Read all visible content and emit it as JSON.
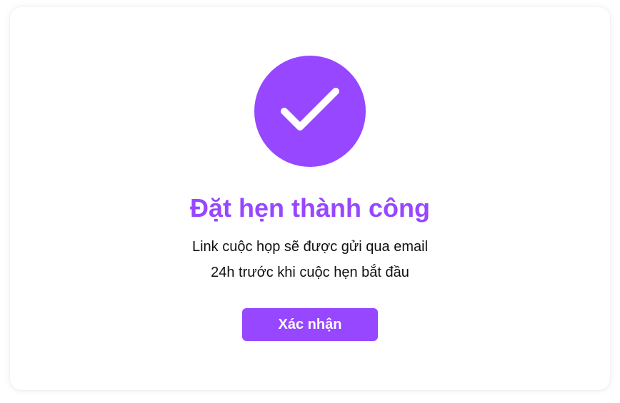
{
  "dialog": {
    "title": "Đặt hẹn thành công",
    "message_line1": "Link cuộc họp sẽ được gửi qua email",
    "message_line2": "24h trước khi cuộc hẹn bắt đầu",
    "confirm_label": "Xác nhận",
    "icon": "check-circle-icon"
  },
  "colors": {
    "accent": "#9747ff",
    "text": "#111111",
    "background": "#ffffff"
  }
}
